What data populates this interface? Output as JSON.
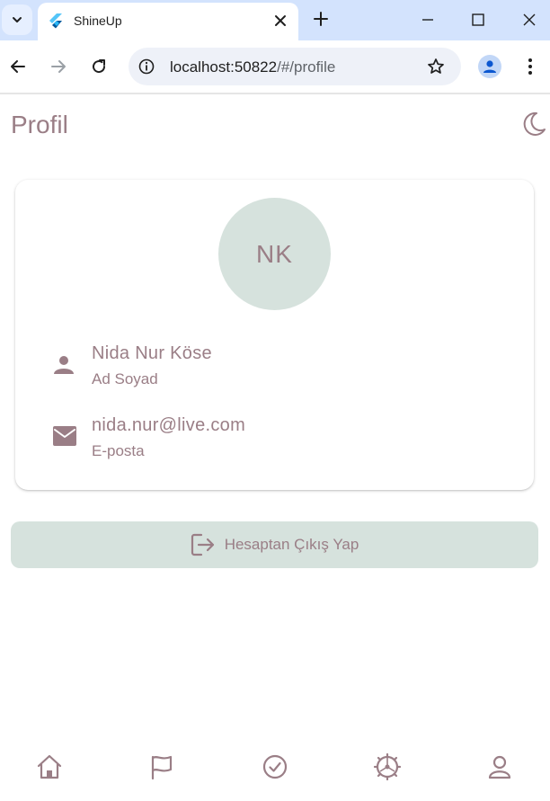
{
  "browser": {
    "tab_title": "ShineUp",
    "url_host": "localhost:50822",
    "url_path": "/#/profile",
    "icons": [
      "tab-search-icon",
      "flutter-icon",
      "close-icon",
      "plus-icon",
      "minimize-icon",
      "maximize-icon",
      "window-close-icon",
      "back-icon",
      "forward-icon",
      "reload-icon",
      "info-icon",
      "star-icon",
      "account-icon",
      "more-vert-icon"
    ]
  },
  "app": {
    "page_title": "Profil",
    "theme_icon": "moon-icon",
    "avatar_initials": "NK",
    "name": {
      "value": "Nida Nur Köse",
      "label": "Ad Soyad",
      "icon": "person-icon"
    },
    "email": {
      "value": "nida.nur@live.com",
      "label": "E-posta",
      "icon": "mail-icon"
    },
    "logout": {
      "label": "Hesaptan Çıkış Yap",
      "icon": "logout-icon"
    },
    "bottom_nav": [
      "home-icon",
      "flag-icon",
      "check-circle-icon",
      "wheel-icon",
      "person-outline-icon"
    ]
  },
  "colors": {
    "accent": "#9a7e86",
    "surface_green": "#d6e2dd",
    "browser_tabbar": "#d3e3fd"
  }
}
